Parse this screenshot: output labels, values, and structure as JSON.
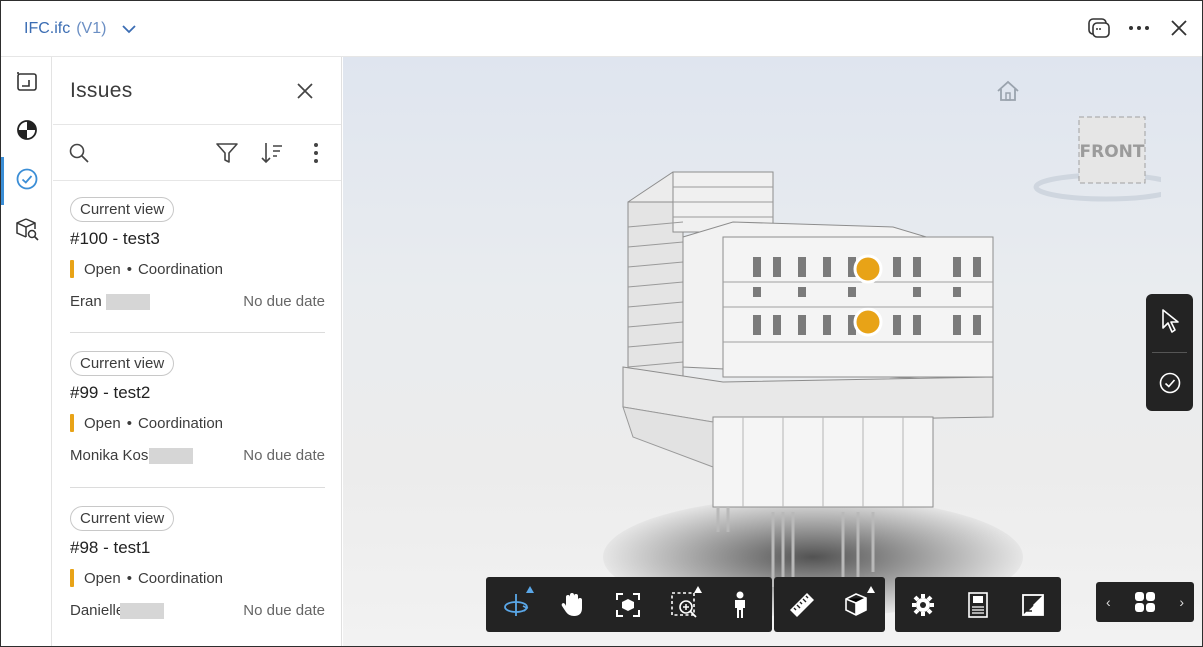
{
  "header": {
    "file_name": "IFC.ifc",
    "version": "(V1)"
  },
  "panel": {
    "title": "Issues"
  },
  "issues": [
    {
      "view_chip": "Current view",
      "title": "#100 - test3",
      "status": "Open",
      "separator": "•",
      "category": "Coordination",
      "assignee": "Eran I",
      "due": "No due date"
    },
    {
      "view_chip": "Current view",
      "title": "#99 - test2",
      "status": "Open",
      "separator": "•",
      "category": "Coordination",
      "assignee": "Monika Kos-",
      "due": "No due date"
    },
    {
      "view_chip": "Current view",
      "title": "#98 - test1",
      "status": "Open",
      "separator": "•",
      "category": "Coordination",
      "assignee": "Danielle",
      "due": "No due date"
    }
  ],
  "viewer": {
    "viewcube_face": "FRONT",
    "issue_marker_color": "#e8a317",
    "nav_prev": "‹",
    "nav_next": "›"
  },
  "colors": {
    "accent": "#3b8ed6",
    "status_open": "#e8a317",
    "toolbar_bg": "#232323"
  }
}
